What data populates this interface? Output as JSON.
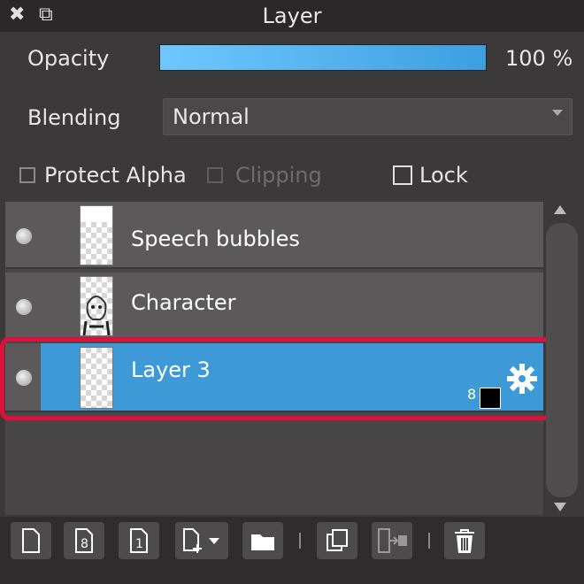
{
  "window": {
    "title": "Layer",
    "close_icon": "✖",
    "popout_icon": "⧉"
  },
  "opacity": {
    "label": "Opacity",
    "value_text": "100 %",
    "fraction": 1.0
  },
  "blending": {
    "label": "Blending",
    "selected": "Normal"
  },
  "options": {
    "protect_alpha": "Protect Alpha",
    "clipping": "Clipping",
    "lock": "Lock"
  },
  "layers": [
    {
      "name": "Speech bubbles",
      "selected": false
    },
    {
      "name": "Character",
      "selected": false
    },
    {
      "name": "Layer 3",
      "selected": true,
      "bit_depth": "8"
    }
  ],
  "colors": {
    "accent": "#3d9ad6",
    "highlight": "#e0103c"
  },
  "toolbar": {
    "icons": [
      "new-layer-icon",
      "new-8bit-layer-icon",
      "new-1bit-layer-icon",
      "add-layer-menu-icon",
      "new-folder-icon",
      "duplicate-layer-icon",
      "merge-layer-icon",
      "delete-layer-icon"
    ],
    "bit8": "8",
    "bit1": "1"
  }
}
